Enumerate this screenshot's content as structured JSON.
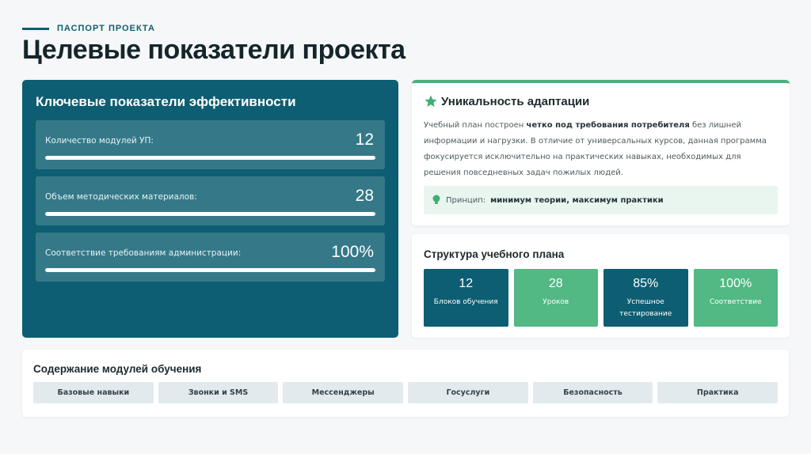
{
  "header": {
    "eyebrow": "ПАСПОРТ ПРОЕКТА",
    "title": "Целевые показатели проекта"
  },
  "kpi": {
    "title": "Ключевые показатели эффективности",
    "items": [
      {
        "label": "Количество модулей УП:",
        "value": "12",
        "progress": 1.0
      },
      {
        "label": "Объем методических материалов:",
        "value": "28",
        "progress": 1.0
      },
      {
        "label": "Соответствие требованиям администрации:",
        "value": "100%",
        "progress": 1.0
      }
    ]
  },
  "uniqueness": {
    "icon": "star-icon",
    "title": "Уникальность адаптации",
    "text_before": "Учебный план построен ",
    "text_bold": "четко под требования потребителя",
    "text_after": " без лишней информации и нагрузки. В отличие от универсальных курсов, данная программа фокусируется исключительно на практических навыках, необходимых для решения повседневных задач пожилых людей.",
    "principle_icon": "lightbulb-icon",
    "principle_label": "Принцип:",
    "principle_value": "минимум теории, максимум практики"
  },
  "structure": {
    "title": "Структура учебного плана",
    "tiles": [
      {
        "value": "12",
        "label": "Блоков обучения",
        "style": "dark"
      },
      {
        "value": "28",
        "label": "Уроков",
        "style": "green"
      },
      {
        "value": "85%",
        "label": "Успешное тестирование",
        "style": "dark"
      },
      {
        "value": "100%",
        "label": "Соответствие",
        "style": "green"
      }
    ]
  },
  "modules": {
    "title": "Содержание модулей обучения",
    "items": [
      "Базовые навыки",
      "Звонки и SMS",
      "Мессенджеры",
      "Госуслуги",
      "Безопасность",
      "Практика"
    ]
  },
  "colors": {
    "primary": "#0d5e72",
    "accent_green": "#52b884",
    "background": "#f6f7f8"
  }
}
